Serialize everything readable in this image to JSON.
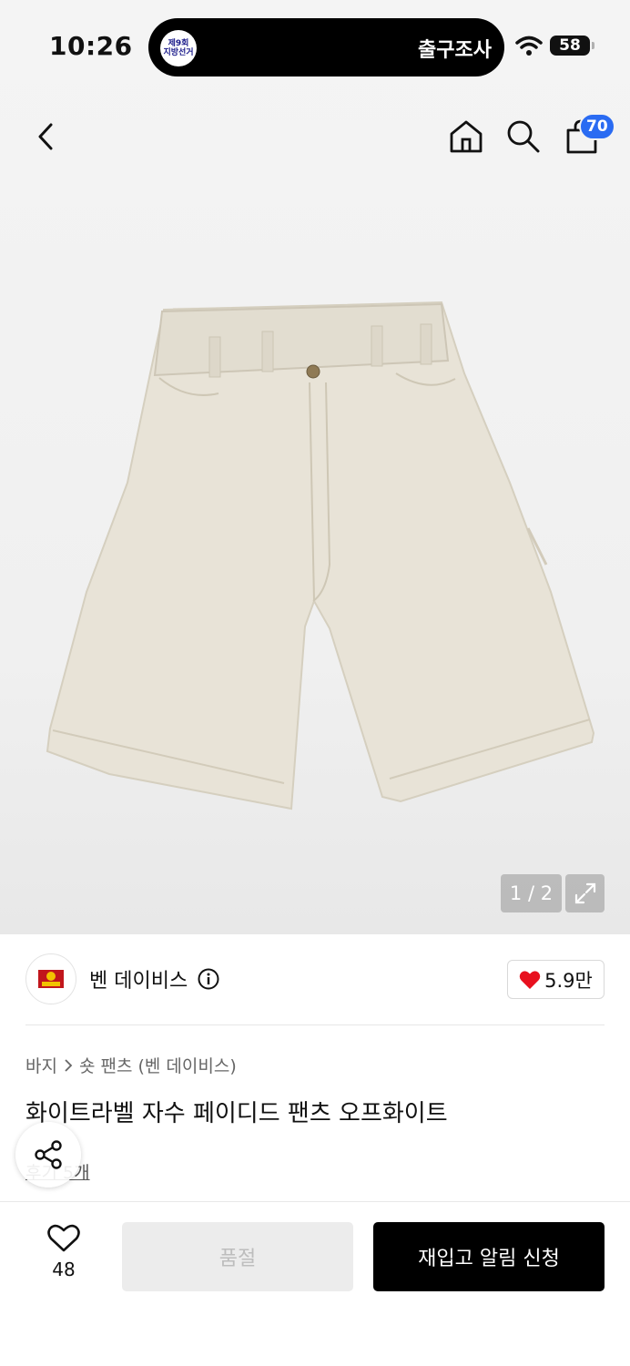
{
  "status_bar": {
    "time": "10:26",
    "island_badge_line1": "제9회",
    "island_badge_line2": "지방선거",
    "island_text": "출구조사",
    "battery": "58"
  },
  "header": {
    "cart_count": "70"
  },
  "gallery": {
    "counter": "1 / 2",
    "accent": "#f3f3f3"
  },
  "brand": {
    "name": "벤 데이비스",
    "likes": "5.9만",
    "heart_color": "#e8101e"
  },
  "breadcrumb": {
    "category": "바지",
    "subcategory": "숏 팬츠 (벤 데이비스)"
  },
  "product": {
    "title": "화이트라벨 자수 페이디드 팬츠 오프화이트",
    "reviews": "후기 5개"
  },
  "bottom_bar": {
    "favorite_count": "48",
    "soldout_label": "품절",
    "restock_label": "재입고 알림 신청"
  }
}
